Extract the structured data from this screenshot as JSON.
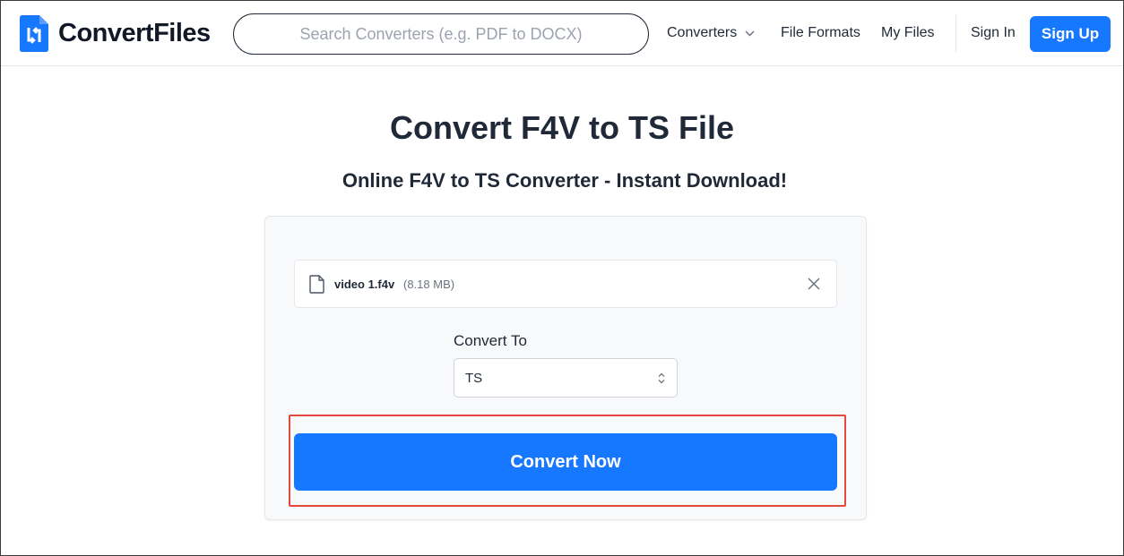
{
  "header": {
    "logo_text": "ConvertFiles",
    "search": {
      "placeholder": "Search Converters (e.g. PDF to DOCX)",
      "value": ""
    },
    "nav": {
      "converters": "Converters",
      "file_formats": "File Formats",
      "my_files": "My Files",
      "sign_in": "Sign In",
      "sign_up": "Sign Up"
    }
  },
  "main": {
    "title": "Convert F4V to TS File",
    "subtitle": "Online F4V to TS Converter - Instant Download!",
    "file": {
      "name": "video 1.f4v",
      "size": "(8.18 MB)"
    },
    "convert_to_label": "Convert To",
    "convert_to_value": "TS",
    "convert_button": "Convert Now"
  },
  "colors": {
    "accent": "#1677ff",
    "highlight": "#e24a3b"
  },
  "icons": [
    "logo-icon",
    "chevron-down-icon",
    "file-icon",
    "close-icon",
    "select-arrows-icon"
  ]
}
